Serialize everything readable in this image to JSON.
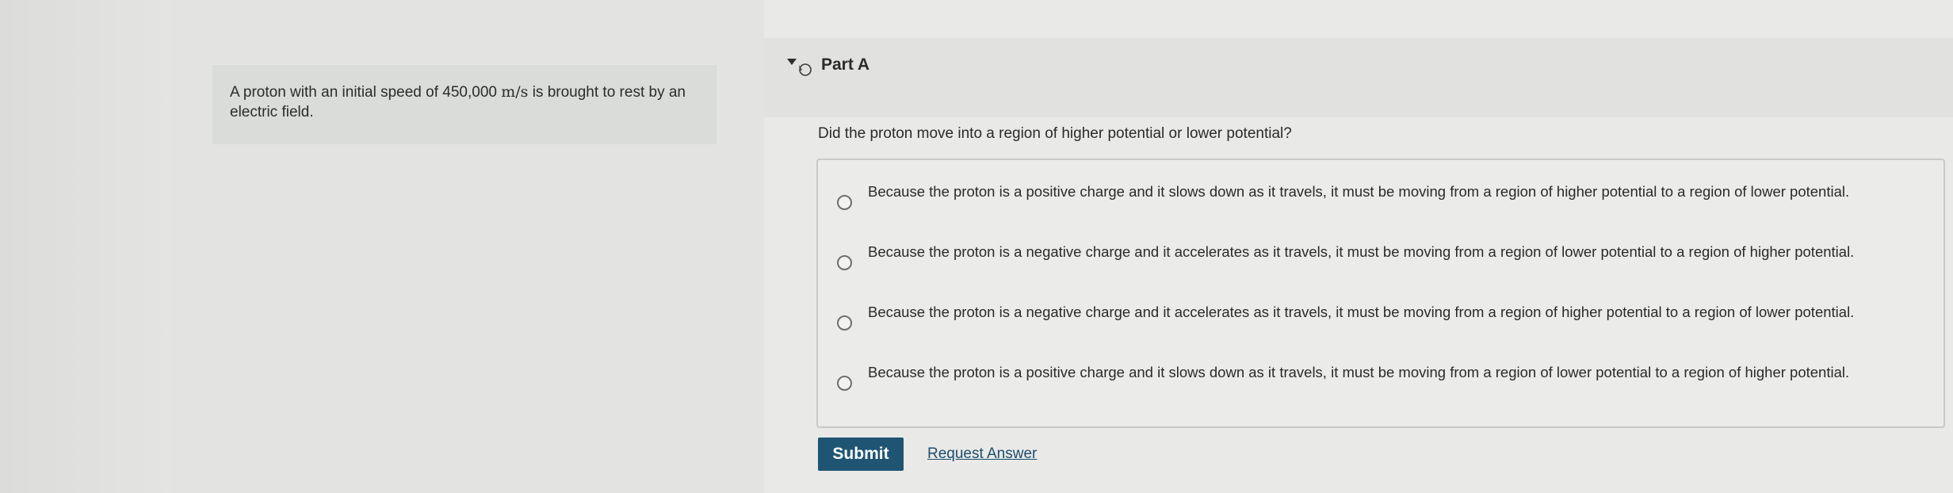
{
  "problem": {
    "text_before": "A proton with an initial speed of 450,000 ",
    "unit": "m/s",
    "text_after": " is brought to rest by an electric field."
  },
  "part": {
    "title": "Part A",
    "toggle_icon": "collapse-arrow-icon"
  },
  "question": "Did the proton move into a region of higher potential or lower potential?",
  "options": [
    {
      "label": "Because the proton is a positive charge and it slows down as it travels, it must be moving from a region of higher potential to a region of lower potential.",
      "selected": false
    },
    {
      "label": "Because the proton is a negative charge and it accelerates as it travels, it must be moving from a region of lower potential to a region of higher potential.",
      "selected": false
    },
    {
      "label": "Because the proton is a negative charge and it accelerates as it travels, it must be moving from a region of higher potential to a region of lower potential.",
      "selected": false
    },
    {
      "label": "Because the proton is a positive charge and it slows down as it travels, it must be moving from a region of lower potential to a region of higher potential.",
      "selected": false
    }
  ],
  "actions": {
    "submit_label": "Submit",
    "request_answer_label": "Request Answer"
  },
  "colors": {
    "submit_background": "#1f5573",
    "link": "#1d4e6e"
  }
}
